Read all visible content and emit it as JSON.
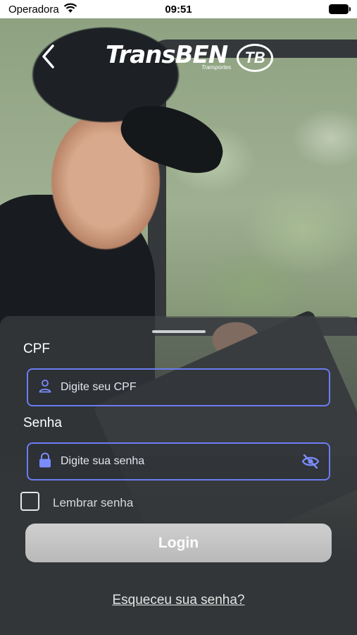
{
  "status_bar": {
    "carrier": "Operadora",
    "time": "09:51"
  },
  "header": {
    "logo_text": "TransBEN",
    "logo_subtext": "Transportes",
    "logo_badge": "TB"
  },
  "form": {
    "cpf_label": "CPF",
    "cpf_placeholder": "Digite seu CPF",
    "password_label": "Senha",
    "password_placeholder": "Digite sua senha",
    "remember_label": "Lembrar senha",
    "login_button": "Login",
    "forgot_link": "Esqueceu sua senha?"
  },
  "colors": {
    "input_border": "#6b7df2",
    "icon_accent": "#7b8cff",
    "button_bg": "#c4c4c4"
  }
}
